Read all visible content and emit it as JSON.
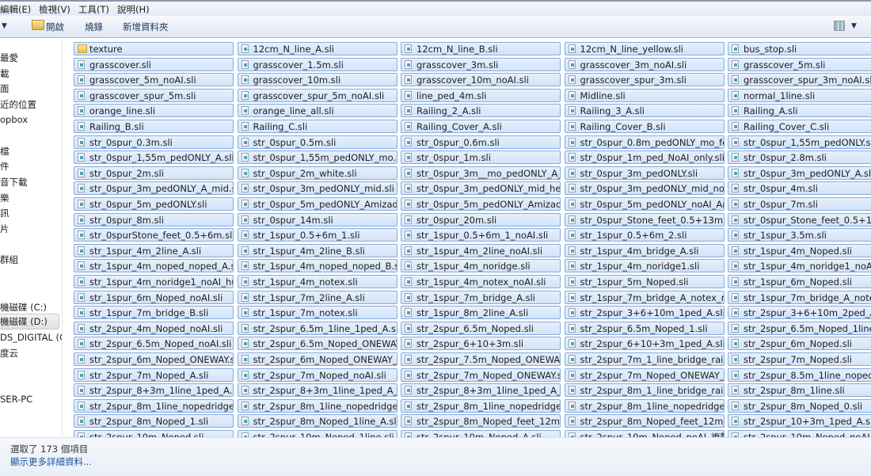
{
  "menu": [
    "編輯(E)",
    "檢視(V)",
    "工具(T)",
    "說明(H)"
  ],
  "toolbar": {
    "open_label": "開啟",
    "burn_label": "燒錄",
    "new_folder_label": "新增資料夾",
    "view_icon": "view-grid-icon",
    "view_dropdown_icon": "chevron-down-icon"
  },
  "sidebar": [
    {
      "label": "最愛",
      "top": 0
    },
    {
      "label": "載"
    },
    {
      "label": "面"
    },
    {
      "label": "近的位置"
    },
    {
      "label": "opbox"
    },
    {
      "label": "檔"
    },
    {
      "label": "件"
    },
    {
      "label": "音下載"
    },
    {
      "label": "樂"
    },
    {
      "label": "訊"
    },
    {
      "label": "片"
    },
    {
      "label": "群組"
    },
    {
      "label": "機磁碟 (C:)"
    },
    {
      "label": "機磁碟 (D:)",
      "selected": true
    },
    {
      "label": "DS_DIGITAL (G:)"
    },
    {
      "label": "度云"
    },
    {
      "label": "SER-PC"
    }
  ],
  "folders": [
    "texture"
  ],
  "files": [
    "texture",
    "12cm_N_line_A.sli",
    "12cm_N_line_B.sli",
    "12cm_N_line_yellow.sli",
    "bus_stop.sli",
    "grasscover.sli",
    "grasscover_1.5m.sli",
    "grasscover_3m.sli",
    "grasscover_3m_noAI.sli",
    "grasscover_5m.sli",
    "grasscover_5m_noAI.sli",
    "grasscover_10m.sli",
    "grasscover_10m_noAI.sli",
    "grasscover_spur_3m.sli",
    "grasscover_spur_3m_noAI.sli",
    "grasscover_spur_5m.sli",
    "grasscover_spur_5m_noAI.sli",
    "line_ped_4m.sli",
    "Midline.sli",
    "normal_1line.sli",
    "orange_line.sli",
    "orange_line_all.sli",
    "Railing_2_A.sli",
    "Railing_3_A.sli",
    "Railing_A.sli",
    "Railing_B.sli",
    "Railing_C.sli",
    "Railing_Cover_A.sli",
    "Railing_Cover_B.sli",
    "Railing_Cover_C.sli",
    "str_0spur_0.3m.sli",
    "str_0spur_0.5m.sli",
    "str_0spur_0.6m.sli",
    "str_0spur_0.8m_pedONLY_mo_fee...",
    "str_0spur_1,55m_pedONLY.sli",
    "str_0spur_1,55m_pedONLY_A.sli",
    "str_0spur_1,55m_pedONLY_mo.sli",
    "str_0spur_1m.sli",
    "str_0spur_1m_ped_NoAI_only.sli",
    "str_0spur_2.8m.sli",
    "str_0spur_2m.sli",
    "str_0spur_2m_white.sli",
    "str_0spur_3m__mo_pedONLY_A_m...",
    "str_0spur_3m_pedONLY.sli",
    "str_0spur_3m_pedONLY_A.sli",
    "str_0spur_3m_pedONLY_A_mid.sli",
    "str_0spur_3m_pedONLY_mid.sli",
    "str_0spur_3m_pedONLY_mid_heig...",
    "str_0spur_3m_pedONLY_mid_noAI...",
    "str_0spur_4m.sli",
    "str_0spur_5m_pedONLY.sli",
    "str_0spur_5m_pedONLY_Amizade.sli",
    "str_0spur_5m_pedONLY_Amizade_...",
    "str_0spur_5m_pedONLY_noAI_Ami...",
    "str_0spur_7m.sli",
    "str_0spur_8m.sli",
    "str_0spur_14m.sli",
    "str_0spur_20m.sli",
    "str_0spur_Stone_feet_0.5+13m.sli",
    "str_0spur_Stone_feet_0.5+13m_1...",
    "str_0spurStone_feet_0.5+6m.sli",
    "str_1spur_0.5+6m_1.sli",
    "str_1spur_0.5+6m_1_noAI.sli",
    "str_1spur_0.5+6m_2.sli",
    "str_1spur_3.5m.sli",
    "str_1spur_4m_2line_A.sli",
    "str_1spur_4m_2line_B.sli",
    "str_1spur_4m_2line_noAI.sli",
    "str_1spur_4m_bridge_A.sli",
    "str_1spur_4m_Noped.sli",
    "str_1spur_4m_noped_noped_A.sli",
    "str_1spur_4m_noped_noped_B.sli",
    "str_1spur_4m_noridge.sli",
    "str_1spur_4m_noridge1.sli",
    "str_1spur_4m_noridge1_noAI.sli",
    "str_1spur_4m_noridge1_noAI_hum...",
    "str_1spur_4m_notex.sli",
    "str_1spur_4m_notex_noAI.sli",
    "str_1spur_5m_Noped.sli",
    "str_1spur_6m_Noped.sli",
    "str_1spur_6m_Noped_noAI.sli",
    "str_1spur_7m_2line_A.sli",
    "str_1spur_7m_bridge_A.sli",
    "str_1spur_7m_bridge_A_notex_noA...",
    "str_1spur_7m_bridge_A_notex_no...",
    "str_1spur_7m_bridge_B.sli",
    "str_1spur_7m_notex.sli",
    "str_1spur_8m_2line_A.sli",
    "str_2spur_3+6+10m_1ped_A.sli",
    "str_2spur_3+6+10m_2ped_A.sli",
    "str_2spur_4m_Noped_noAI.sli",
    "str_2spur_6.5m_1line_1ped_A.sli",
    "str_2spur_6.5m_Noped.sli",
    "str_2spur_6.5m_Noped_1.sli",
    "str_2spur_6.5m_Noped_1line.sli",
    "str_2spur_6.5m_Noped_noAI.sli",
    "str_2spur_6.5m_Noped_ONEWAY.sli",
    "str_2spur_6+10+3m.sli",
    "str_2spur_6+10+3m_1ped_A.sli",
    "str_2spur_6m_Noped.sli",
    "str_2spur_6m_Noped_ONEWAY.sli",
    "str_2spur_6m_Noped_ONEWAY_1...",
    "str_2spur_7.5m_Noped_ONEWAY_...",
    "str_2spur_7m_1_line_bridge_rail_O...",
    "str_2spur_7m_Noped.sli",
    "str_2spur_7m_Noped_A.sli",
    "str_2spur_7m_Noped_noAI.sli",
    "str_2spur_7m_Noped_ONEWAY.sli",
    "str_2spur_7m_Noped_ONEWAY_st...",
    "str_2spur_8.5m_1line_nopedridge...",
    "str_2spur_8+3m_1line_1ped_A.sli",
    "str_2spur_8+3m_1line_1ped_A_no...",
    "str_2spur_8+3m_1line_1ped_A_no...",
    "str_2spur_8m_1_line_bridge_rail_O...",
    "str_2spur_8m_1line.sli",
    "str_2spur_8m_1line_nopedridge.sli",
    "str_2spur_8m_1line_nopedridge_1...",
    "str_2spur_8m_1line_nopedridge_1...",
    "str_2spur_8m_1line_nopedridge_n...",
    "str_2spur_8m_Noped_0.sli",
    "str_2spur_8m_Noped_1.sli",
    "str_2spur_8m_Noped_1line_A.sli",
    "str_2spur_8m_Noped_feet_12m.sli",
    "str_2spur_8m_Noped_feet_12m_n...",
    "str_2spur_10+3m_1ped_A.sli",
    "str_2spur_10m_Noped.sli",
    "str_2spur_10m_Noped_1line.sli",
    "str_2spur_10m_Noped_A.sli",
    "str_2spur_10m_Noped_noAI_複製...",
    "str_2spur_10m_Noped_noAI.sli"
  ],
  "status": {
    "selection": "選取了 173 個項目",
    "more_details": "顯示更多詳細資料..."
  },
  "colors": {
    "selection_border": "#84acdd",
    "selection_fill": "#d3e3f8",
    "link": "#1b4f99"
  }
}
